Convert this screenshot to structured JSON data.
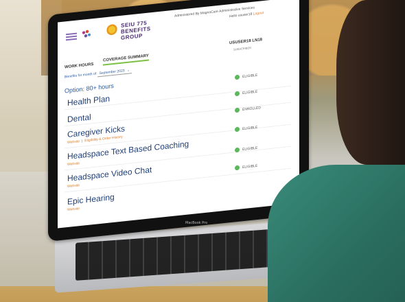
{
  "header": {
    "brand_line1": "SEIU 775",
    "brand_line2": "BENEFITS GROUP",
    "administered_by": "Administered By MagnaCare Administrative Services",
    "hello_text": "Hello ususer18",
    "logout": "Logout"
  },
  "tabs": [
    {
      "label": "WORK HOURS"
    },
    {
      "label": "COVERAGE SUMMARY",
      "active": true
    }
  ],
  "column": {
    "header": "USUSER18 LN18",
    "subheader": "SUBSCRIBER"
  },
  "benefits_for_month": {
    "label": "Benefits for month of",
    "value": "September 2023"
  },
  "option_text": "Option: 80+ hours",
  "plans": [
    {
      "name": "Health Plan",
      "status": "ELIGIBLE"
    },
    {
      "name": "Dental",
      "status": "ELIGIBLE"
    },
    {
      "name": "Caregiver Kicks",
      "status": "ENROLLED",
      "links": [
        "Website",
        "Eligibility & Order History"
      ]
    },
    {
      "name": "Headspace Text Based Coaching",
      "status": "ELIGIBLE",
      "links": [
        "Website"
      ]
    },
    {
      "name": "Headspace Video Chat",
      "status": "ELIGIBLE",
      "links": [
        "Website"
      ]
    },
    {
      "name": "Epic Hearing",
      "status": "ELIGIBLE",
      "links": [
        "Website"
      ]
    }
  ],
  "device_label": "MacBook Pro",
  "icons": {
    "menu": "hamburger-menu-icon",
    "logo_mark": "dots-logo-icon",
    "sun": "sun-logo-icon",
    "status_check": "check-circle-icon"
  },
  "colors": {
    "primary_text": "#1f3f7a",
    "accent_orange": "#e07a1f",
    "brand_purple": "#4b2d73",
    "tab_underline": "#7bc043",
    "status_green": "#5cb85c"
  }
}
